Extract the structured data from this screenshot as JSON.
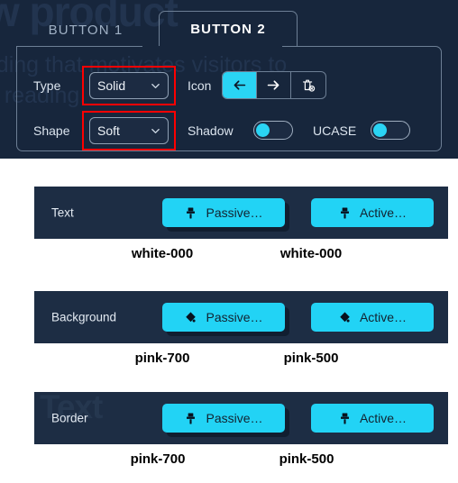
{
  "config": {
    "tabs": [
      {
        "label": "BUTTON 1",
        "active": false
      },
      {
        "label": "BUTTON 2",
        "active": true
      }
    ],
    "controls": {
      "type_label": "Type",
      "type_value": "Solid",
      "shape_label": "Shape",
      "shape_value": "Soft",
      "icon_label": "Icon",
      "icon_options": [
        "arrow-left-icon",
        "arrow-right-icon",
        "trash-disabled-icon"
      ],
      "icon_selected_index": 0,
      "shadow_label": "Shadow",
      "shadow_on": false,
      "ucase_label": "UCASE",
      "ucase_on": false
    },
    "ghost_text": {
      "line1": "w product",
      "line2": "eading that motivates visitors to",
      "line3": "e reading."
    },
    "colors": {
      "panel_bg": "#17263c",
      "border": "#6d7f95",
      "accent": "#2ad4f4",
      "highlight_box": "#fe0000"
    }
  },
  "sections": [
    {
      "label": "Text",
      "icon": "brush-icon",
      "ghost": "",
      "buttons": [
        {
          "label": "Passive…",
          "state": "passive",
          "swatch": "white-000"
        },
        {
          "label": "Active…",
          "state": "active",
          "swatch": "white-000"
        }
      ]
    },
    {
      "label": "Background",
      "icon": "paint-bucket-icon",
      "ghost": "",
      "buttons": [
        {
          "label": "Passive…",
          "state": "passive",
          "swatch": "pink-700"
        },
        {
          "label": "Active…",
          "state": "active",
          "swatch": "pink-500"
        }
      ]
    },
    {
      "label": "Border",
      "icon": "brush-icon",
      "ghost": "Text",
      "buttons": [
        {
          "label": "Passive…",
          "state": "passive",
          "swatch": "pink-700"
        },
        {
          "label": "Active…",
          "state": "active",
          "swatch": "pink-500"
        }
      ]
    }
  ]
}
